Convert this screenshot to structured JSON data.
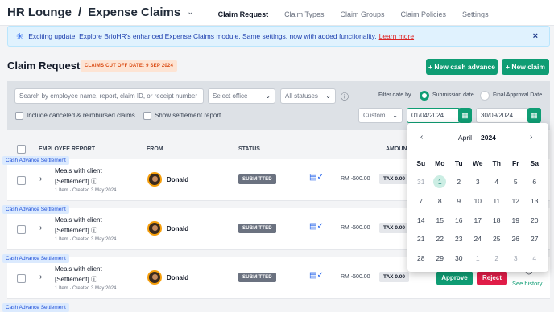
{
  "app": {
    "title": "HR Lounge",
    "section": "Expense Claims",
    "separator": "/"
  },
  "tabs": [
    "Claim Request",
    "Claim Types",
    "Claim Groups",
    "Claim Policies",
    "Settings"
  ],
  "banner": {
    "text": "Exciting update! Explore BrioHR's enhanced Expense Claims module. Same settings, now with added functionality.",
    "link": "Learn more",
    "close": "×"
  },
  "page": {
    "title": "Claim Request",
    "cutoff": "CLAIMS CUT OFF DATE: 9 SEP 2024"
  },
  "buttons": {
    "cash_advance": "+ New cash advance",
    "new_claim": "+ New claim"
  },
  "filters": {
    "search_placeholder": "Search by employee name, report, claim ID, or receipt number",
    "office": "Select office",
    "status": "All statuses",
    "filter_by": "Filter date by",
    "submission": "Submission date",
    "final_approval": "Final Approval Date",
    "include_canceled": "Include canceled & reimbursed claims",
    "show_settlement": "Show settlement report",
    "range": "Custom",
    "start_date": "01/04/2024",
    "end_date": "30/09/2024"
  },
  "table": {
    "headers": {
      "report": "EMPLOYEE REPORT",
      "from": "FROM",
      "status": "STATUS",
      "amount": "AMOUN"
    },
    "rows": [
      {
        "tag": "Cash Advance Settlement",
        "title": "Meals with client",
        "subtitle": "[Settlement]",
        "meta": "1 Item · Created 3 May 2024",
        "name": "Donald",
        "status": "SUBMITTED",
        "amount": "RM -500.00",
        "tax": "TAX 0.00"
      },
      {
        "tag": "Cash Advance Settlement",
        "title": "Meals with client",
        "subtitle": "[Settlement]",
        "meta": "1 Item · Created 3 May 2024",
        "name": "Donald",
        "status": "SUBMITTED",
        "amount": "RM -500.00",
        "tax": "TAX 0.00"
      },
      {
        "tag": "Cash Advance Settlement",
        "title": "Meals with client",
        "subtitle": "[Settlement]",
        "meta": "1 Item · Created 3 May 2024",
        "name": "Donald",
        "status": "SUBMITTED",
        "amount": "RM -500.00",
        "tax": "TAX 0.00"
      }
    ],
    "next_tag": "Cash Advance Settlement",
    "approve": "Approve",
    "reject": "Reject",
    "history": "See history"
  },
  "calendar": {
    "month": "April",
    "year": "2024",
    "weekdays": [
      "Su",
      "Mo",
      "Tu",
      "We",
      "Th",
      "Fr",
      "Sa"
    ],
    "selected_day": "1",
    "days": [
      [
        "31",
        "1",
        "2",
        "3",
        "4",
        "5",
        "6"
      ],
      [
        "7",
        "8",
        "9",
        "10",
        "11",
        "12",
        "13"
      ],
      [
        "14",
        "15",
        "16",
        "17",
        "18",
        "19",
        "20"
      ],
      [
        "21",
        "22",
        "23",
        "24",
        "25",
        "26",
        "27"
      ],
      [
        "28",
        "29",
        "30",
        "1",
        "2",
        "3",
        "4"
      ]
    ]
  },
  "colors": {
    "accent": "#0f9d74",
    "reject": "#e11d48",
    "banner_bg": "#e0f2fe",
    "cutoff_text": "#d9480f"
  },
  "icons": [
    "chevron-down-icon",
    "sparkle-icon",
    "close-icon",
    "info-icon",
    "calendar-icon",
    "chevron-left-icon",
    "chevron-right-icon",
    "receipt-icon",
    "avatar",
    "history-icon"
  ]
}
